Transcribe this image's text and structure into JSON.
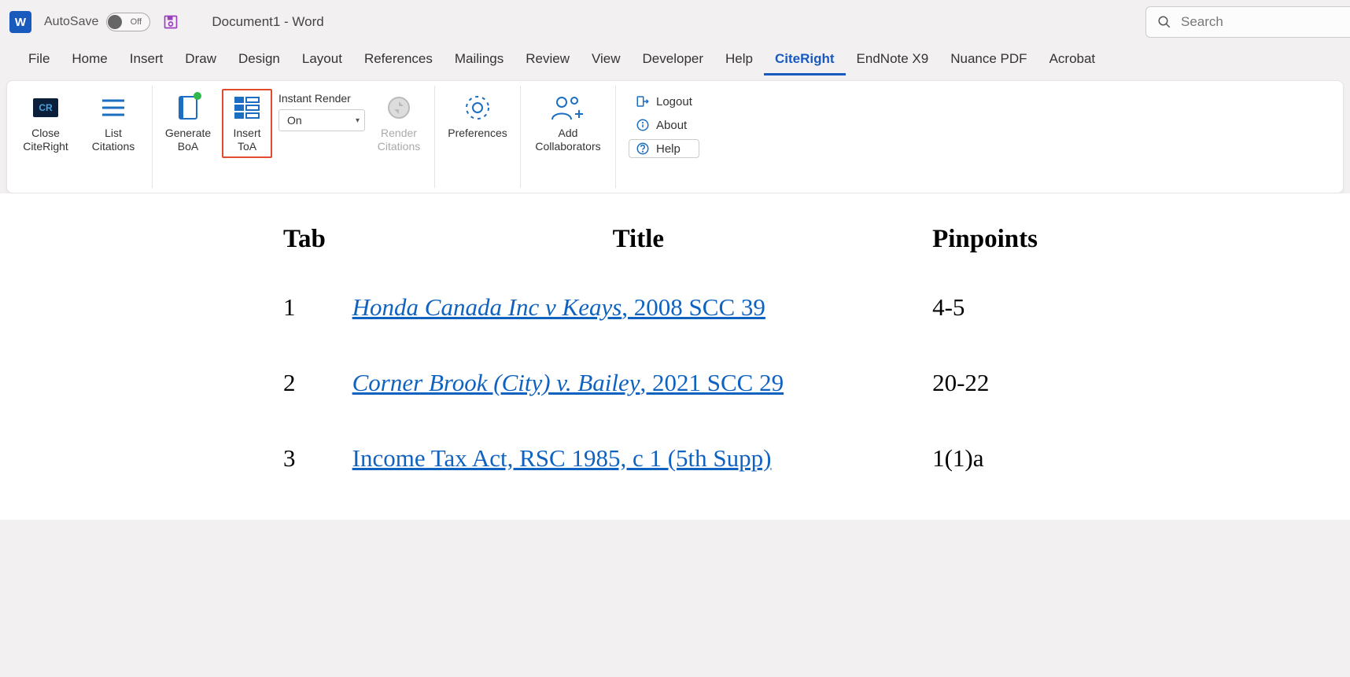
{
  "titlebar": {
    "autosave_label": "AutoSave",
    "autosave_state": "Off",
    "doc_title": "Document1  -  Word",
    "search_placeholder": "Search"
  },
  "menu": {
    "items": [
      "File",
      "Home",
      "Insert",
      "Draw",
      "Design",
      "Layout",
      "References",
      "Mailings",
      "Review",
      "View",
      "Developer",
      "Help",
      "CiteRight",
      "EndNote X9",
      "Nuance PDF",
      "Acrobat"
    ],
    "active": "CiteRight"
  },
  "ribbon": {
    "close": "Close CiteRight",
    "list": "List Citations",
    "generate": "Generate BoA",
    "insert_toa": "Insert ToA",
    "instant_render_label": "Instant Render",
    "instant_render_value": "On",
    "render": "Render Citations",
    "preferences": "Preferences",
    "add_collab": "Add Collaborators",
    "logout": "Logout",
    "about": "About",
    "help": "Help"
  },
  "toa": {
    "headers": {
      "tab": "Tab",
      "title": "Title",
      "pin": "Pinpoints"
    },
    "rows": [
      {
        "tab": "1",
        "case": "Honda Canada Inc v Keays",
        "cite": ", 2008 SCC 39",
        "pin": "4-5"
      },
      {
        "tab": "2",
        "case": "Corner Brook (City) v. Bailey",
        "cite": ", 2021 SCC 29",
        "pin": "20-22"
      },
      {
        "tab": "3",
        "case": "Income Tax Act, RSC 1985, c 1 (5th Supp)",
        "cite": "",
        "pin": "1(1)a"
      }
    ]
  }
}
